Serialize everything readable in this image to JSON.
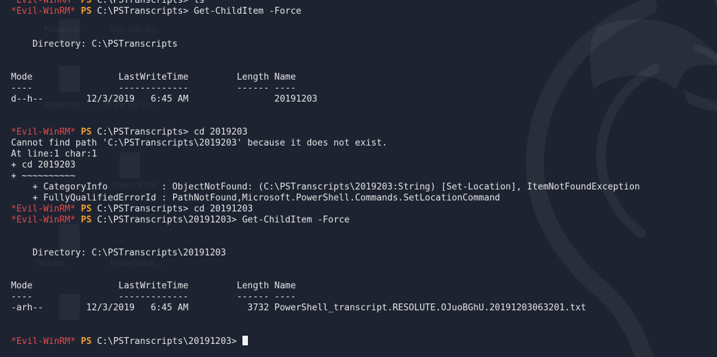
{
  "prompt": {
    "tag": "*Evil-WinRM*",
    "ps": "PS"
  },
  "lines": [
    {
      "type": "prompt",
      "path": "C:\\PSTranscripts>",
      "cmd": "ls"
    },
    {
      "type": "prompt",
      "path": "C:\\PSTranscripts>",
      "cmd": "Get-ChildItem -Force"
    },
    {
      "type": "text",
      "text": ""
    },
    {
      "type": "text",
      "text": ""
    },
    {
      "type": "text",
      "text": "    Directory: C:\\PSTranscripts"
    },
    {
      "type": "text",
      "text": ""
    },
    {
      "type": "text",
      "text": ""
    },
    {
      "type": "text",
      "text": "Mode                LastWriteTime         Length Name"
    },
    {
      "type": "text",
      "text": "----                -------------         ------ ----"
    },
    {
      "type": "text",
      "text": "d--h--        12/3/2019   6:45 AM                20191203"
    },
    {
      "type": "text",
      "text": ""
    },
    {
      "type": "text",
      "text": ""
    },
    {
      "type": "prompt",
      "path": "C:\\PSTranscripts>",
      "cmd": "cd 2019203"
    },
    {
      "type": "text",
      "text": "Cannot find path 'C:\\PSTranscripts\\2019203' because it does not exist."
    },
    {
      "type": "text",
      "text": "At line:1 char:1"
    },
    {
      "type": "text",
      "text": "+ cd 2019203"
    },
    {
      "type": "text",
      "text": "+ ~~~~~~~~~~"
    },
    {
      "type": "text",
      "text": "    + CategoryInfo          : ObjectNotFound: (C:\\PSTranscripts\\2019203:String) [Set-Location], ItemNotFoundException"
    },
    {
      "type": "text",
      "text": "    + FullyQualifiedErrorId : PathNotFound,Microsoft.PowerShell.Commands.SetLocationCommand"
    },
    {
      "type": "prompt",
      "path": "C:\\PSTranscripts>",
      "cmd": "cd 20191203"
    },
    {
      "type": "prompt",
      "path": "C:\\PSTranscripts\\20191203>",
      "cmd": "Get-ChildItem -Force"
    },
    {
      "type": "text",
      "text": ""
    },
    {
      "type": "text",
      "text": ""
    },
    {
      "type": "text",
      "text": "    Directory: C:\\PSTranscripts\\20191203"
    },
    {
      "type": "text",
      "text": ""
    },
    {
      "type": "text",
      "text": ""
    },
    {
      "type": "text",
      "text": "Mode                LastWriteTime         Length Name"
    },
    {
      "type": "text",
      "text": "----                -------------         ------ ----"
    },
    {
      "type": "text",
      "text": "-arh--        12/3/2019   6:45 AM           3732 PowerShell_transcript.RESOLUTE.OJuoBGhU.20191203063201.txt"
    },
    {
      "type": "text",
      "text": ""
    },
    {
      "type": "text",
      "text": ""
    },
    {
      "type": "prompt",
      "path": "C:\\PSTranscripts\\20191203>",
      "cmd": "",
      "cursor": true
    }
  ],
  "ghost_labels": [
    "PowerUp....",
    "Exp.Get.ps...",
    "PowerUp....",
    "PowerUp.ps...",
    "PowerView....",
    "Invoke...",
    "PowerView...."
  ],
  "colors": {
    "background": "#1e2331",
    "text": "#e4e4e6",
    "prompt_tag": "#e04b4b",
    "ps": "#f0a030"
  }
}
